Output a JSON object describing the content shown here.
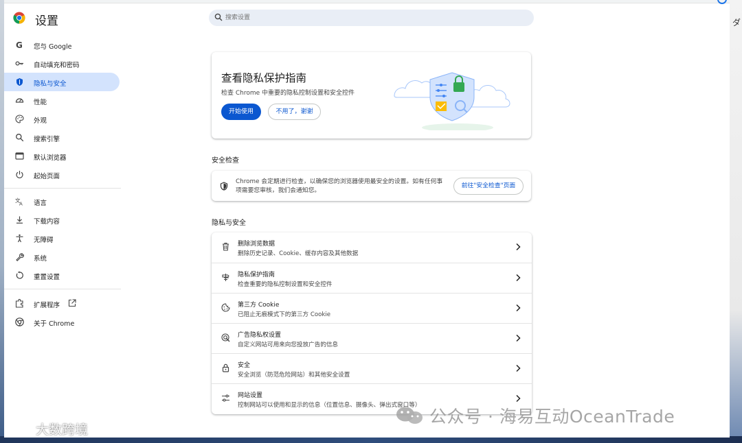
{
  "app": {
    "title": "设置"
  },
  "search": {
    "placeholder": "搜索设置"
  },
  "sidebar": {
    "items": [
      {
        "label": "您与 Google",
        "icon": "google-g-icon"
      },
      {
        "label": "自动填充和密码",
        "icon": "key-icon"
      },
      {
        "label": "隐私与安全",
        "icon": "shield-icon",
        "active": true
      },
      {
        "label": "性能",
        "icon": "speedometer-icon"
      },
      {
        "label": "外观",
        "icon": "palette-icon"
      },
      {
        "label": "搜索引擎",
        "icon": "search-icon"
      },
      {
        "label": "默认浏览器",
        "icon": "browser-window-icon"
      },
      {
        "label": "起始页面",
        "icon": "power-icon"
      },
      {
        "label": "语言",
        "icon": "translate-icon"
      },
      {
        "label": "下载内容",
        "icon": "download-icon"
      },
      {
        "label": "无障碍",
        "icon": "accessibility-icon"
      },
      {
        "label": "系统",
        "icon": "wrench-icon"
      },
      {
        "label": "重置设置",
        "icon": "reset-icon"
      },
      {
        "label": "扩展程序",
        "icon": "puzzle-icon"
      },
      {
        "label": "关于 Chrome",
        "icon": "chrome-icon"
      }
    ]
  },
  "privacy_guide": {
    "title": "查看隐私保护指南",
    "subtitle": "检查 Chrome 中重要的隐私控制设置和安全控件",
    "start_button": "开始使用",
    "dismiss_button": "不用了，谢谢"
  },
  "safety_check": {
    "section_title": "安全检查",
    "text": "Chrome 会定期进行检查，以确保您的浏览器使用最安全的设置。如有任何事项需要您审核，我们会通知您。",
    "button": "前往\"安全检查\"页面"
  },
  "privacy_security": {
    "section_title": "隐私与安全",
    "rows": [
      {
        "title": "删除浏览数据",
        "subtitle": "删除历史记录、Cookie、缓存内容及其他数据",
        "icon": "trash-icon"
      },
      {
        "title": "隐私保护指南",
        "subtitle": "检查重要的隐私控制设置和安全控件",
        "icon": "guide-icon"
      },
      {
        "title": "第三方 Cookie",
        "subtitle": "已阻止无痕模式下的第三方 Cookie",
        "icon": "cookie-icon"
      },
      {
        "title": "广告隐私权设置",
        "subtitle": "自定义网站可用来向您投放广告的信息",
        "icon": "ad-privacy-icon"
      },
      {
        "title": "安全",
        "subtitle": "安全浏览（防范危险网站）和其他安全设置",
        "icon": "lock-icon"
      },
      {
        "title": "网站设置",
        "subtitle": "控制网站可以使用和显示的信息（位置信息、摄像头、弹出式窗口等）",
        "icon": "sliders-icon"
      }
    ]
  },
  "watermarks": {
    "right": "公众号 · 海易互动OceanTrade",
    "left": "大数跨境"
  },
  "colors": {
    "accent": "#0b57d0",
    "active_bg": "#d3e3fd"
  }
}
